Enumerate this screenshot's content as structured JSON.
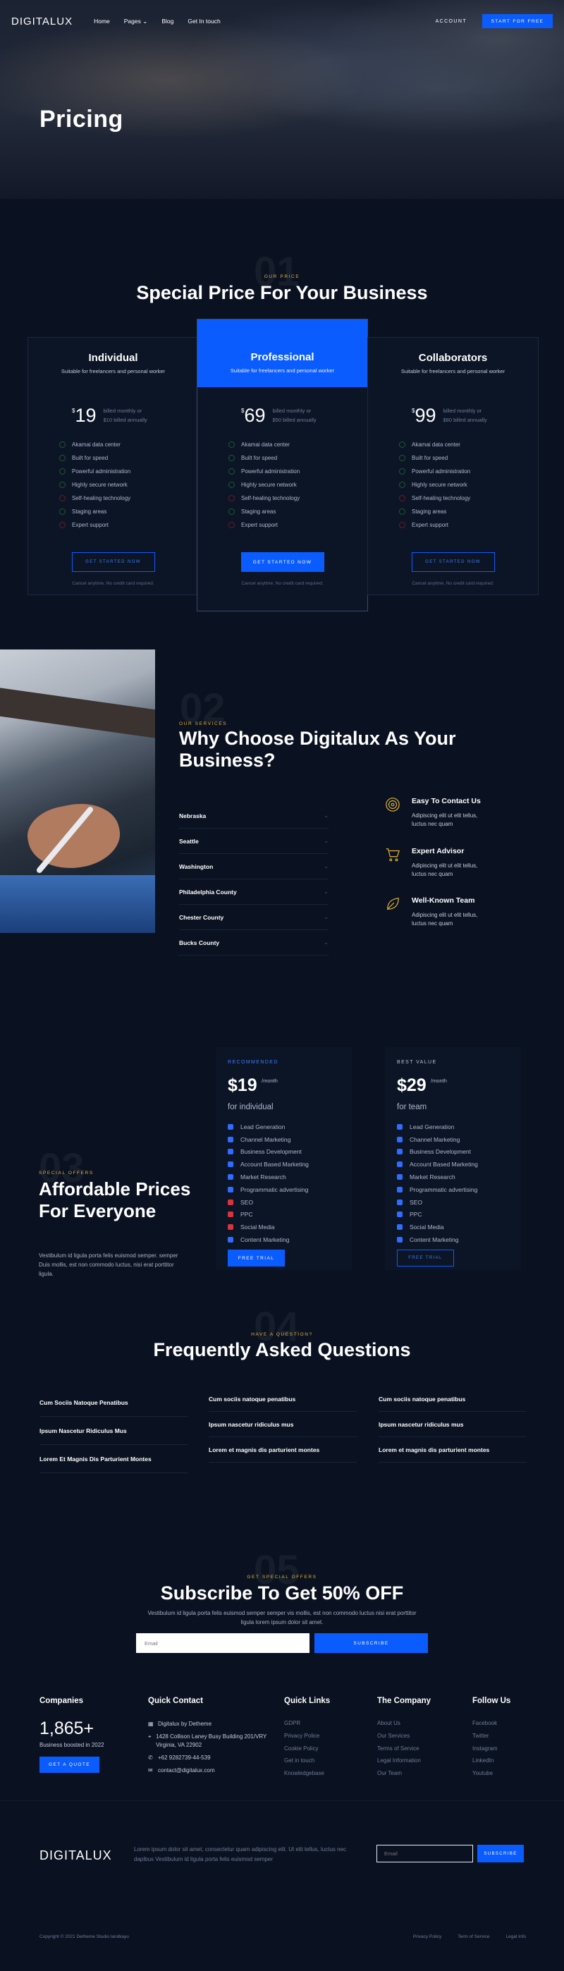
{
  "nav": {
    "logo": "DIGITALUX",
    "links": [
      "Home",
      "Pages",
      "Blog",
      "Get In touch"
    ],
    "account": "ACCOUNT",
    "cta": "START FOR FREE"
  },
  "hero": {
    "title": "Pricing"
  },
  "pricing": {
    "number": "01",
    "eyebrow": "OUR PRICE",
    "title": "Special Price For Your Business",
    "plans": [
      {
        "name": "Individual",
        "sub": "Suitable for freelancers and personal worker",
        "currency": "$",
        "amount": "19",
        "bill1": "billed monthly or",
        "bill2": "$10 billed annually",
        "cta": "GET STARTED NOW",
        "note": "Cancel anytime. No credit card required."
      },
      {
        "name": "Professional",
        "sub": "Suitable for freelancers and personal worker",
        "currency": "$",
        "amount": "69",
        "bill1": "billed monthly or",
        "bill2": "$50 billed annually",
        "cta": "GET STARTED NOW",
        "note": "Cancel anytime. No credit card required."
      },
      {
        "name": "Collaborators",
        "sub": "Suitable for freelancers and personal worker",
        "currency": "$",
        "amount": "99",
        "bill1": "billed monthly or",
        "bill2": "$80 billed annually",
        "cta": "GET STARTED NOW",
        "note": "Cancel anytime. No credit card required."
      }
    ],
    "features": [
      "Akamai data center",
      "Built for speed",
      "Powerful administration",
      "Highly secure network",
      "Self-healing technology",
      "Staging areas",
      "Expert support"
    ],
    "included": [
      true,
      true,
      true,
      true,
      false,
      true,
      false
    ]
  },
  "why": {
    "number": "02",
    "eyebrow": "OUR SERVICES",
    "title": "Why Choose Digitalux As Your Business?",
    "accordion": [
      "Nebraska",
      "Seattle",
      "Washington",
      "Philadelphia County",
      "Chester County",
      "Bucks County"
    ],
    "advantages": [
      {
        "title": "Easy To Contact Us",
        "desc": "Adipiscing elit ut elit tellus, luctus nec quam",
        "icon": "target-icon"
      },
      {
        "title": "Expert Advisor",
        "desc": "Adipiscing elit ut elit tellus, luctus nec quam",
        "icon": "cart-icon"
      },
      {
        "title": "Well-Known Team",
        "desc": "Adipiscing elit ut elit tellus, luctus nec quam",
        "icon": "leaf-icon"
      }
    ]
  },
  "offers": {
    "number": "03",
    "eyebrow": "SPECIAL OFFERS",
    "title": "Affordable Prices For Everyone",
    "desc": "Vestibulum id ligula porta felis euismod semper. semper Duis mollis, est non commodo luctus, nisi erat porttitor ligula.",
    "cards": [
      {
        "label": "RECOMMENDED",
        "price": "$19",
        "period": "/month",
        "for": "for individual",
        "cta": "FREE TRIAL"
      },
      {
        "label": "BEST VALUE",
        "price": "$29",
        "period": "/month",
        "for": "for team",
        "cta": "FREE TRIAL"
      }
    ],
    "items": [
      "Lead Generation",
      "Channel Marketing",
      "Business Development",
      "Account Based Marketing",
      "Market Research",
      "Programmatic advertising",
      "SEO",
      "PPC",
      "Social Media",
      "Content Marketing"
    ]
  },
  "faq": {
    "number": "04",
    "eyebrow": "HAVE A QUESTION?",
    "title": "Frequently Asked Questions",
    "col1": [
      "Cum Sociis Natoque Penatibus",
      "Ipsum Nascetur Ridiculus Mus",
      "Lorem Et Magnis Dis Parturient Montes"
    ],
    "col2": [
      "Cum sociis natoque penatibus",
      "Ipsum nascetur ridiculus mus",
      "Lorem et magnis dis parturient montes"
    ],
    "col3": [
      "Cum sociis natoque penatibus",
      "Ipsum nascetur ridiculus mus",
      "Lorem et magnis dis parturient montes"
    ]
  },
  "subscribe": {
    "number": "05",
    "eyebrow": "GET SPECIAL OFFERS",
    "title": "Subscribe To Get 50% OFF",
    "desc": "Vestibulum id ligula porta felis euismod semper semper vis mollis, est non commodo luctus nisi erat porttitor ligula lorem ipsum dolor sit amet.",
    "placeholder": "Email",
    "button": "SUBSCRIBE"
  },
  "footer": {
    "companies": {
      "heading": "Companies",
      "count": "1,865+",
      "caption": "Business boosted in 2022",
      "cta": "GET A QUOTE"
    },
    "contact": {
      "heading": "Quick Contact",
      "company": "Digitalux by Detheme",
      "address": "1428 Collison Laney Busy Building 201/VRY Virginia, VA 22902",
      "phone": "+62 9282739-44-539",
      "email": "contact@digitalux.com"
    },
    "quick": {
      "heading": "Quick Links",
      "links": [
        "GDPR",
        "Privacy Police",
        "Cookie Policy",
        "Get in touch",
        "Knowledgebase"
      ]
    },
    "company": {
      "heading": "The Company",
      "links": [
        "About Us",
        "Our Services",
        "Terms of Service",
        "Legal Information",
        "Our Team"
      ]
    },
    "follow": {
      "heading": "Follow Us",
      "links": [
        "Facebook",
        "Twitter",
        "Instagram",
        "LinkedIn",
        "Youtube"
      ]
    },
    "logo": "DIGITALUX",
    "desc": "Lorem ipsum dolor sit amet, consectetur quam adipiscing elit. Ut elit tellus, luctus nec dapibus Vestibulum id ligula porta felis euismod semper",
    "email_placeholder": "Email",
    "subscribe": "SUBSCRIBE",
    "copyright": "Copyright © 2021 Detheme Studio landkayu",
    "bottom_links": [
      "Privacy Policy",
      "Term of Service",
      "Legal Info"
    ]
  },
  "colors": {
    "background": "#0a1120",
    "accent": "#0a5cff",
    "eyebrow": "#e2b43c",
    "check_ok": "#1f5a2e",
    "check_no": "#6b1c24"
  }
}
